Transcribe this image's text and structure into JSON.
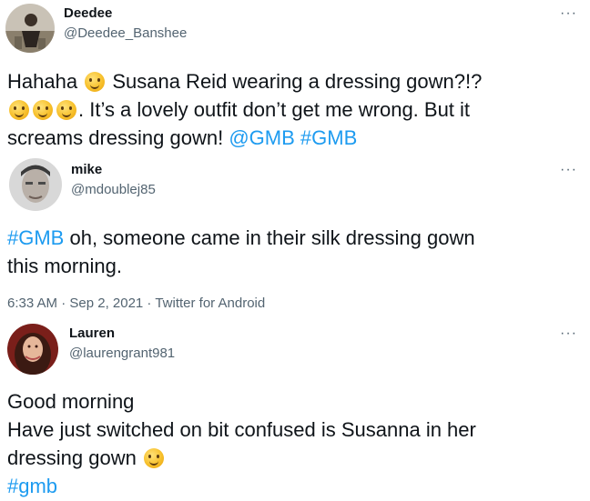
{
  "tweets": [
    {
      "name": "Deedee",
      "handle": "@Deedee_Banshee",
      "more": "···",
      "text": {
        "p1": "Hahaha",
        "p2": "Susana Reid wearing a dressing gown?!?",
        "p3": ". It’s a lovely outfit don’t get me wrong. But it",
        "p4": "screams dressing gown!",
        "mention": "@GMB",
        "hashtag": "#GMB"
      },
      "emojis": [
        "rolling-on-floor-laughing-emoji",
        "thinking-face-emoji",
        "grinning-sweat-emoji",
        "rolling-on-floor-laughing-emoji"
      ]
    },
    {
      "name": "mike",
      "handle": "@mdoublej85",
      "more": "···",
      "text": {
        "hashtag": "#GMB",
        "p1": " oh, someone came in their silk dressing gown",
        "p2": "this morning."
      },
      "meta": "6:33 AM · Sep 2, 2021 · Twitter for Android"
    },
    {
      "name": "Lauren",
      "handle": "@laurengrant981",
      "more": "···",
      "text": {
        "p1": "Good morning",
        "p2": "Have just switched on bit confused is Susanna in her",
        "p3": "dressing gown",
        "hashtag": "#gmb"
      },
      "emojis": [
        "thinking-face-emoji"
      ]
    }
  ],
  "colors": {
    "link": "#1d9bf0",
    "secondary": "#536471",
    "text": "#0f1419"
  }
}
